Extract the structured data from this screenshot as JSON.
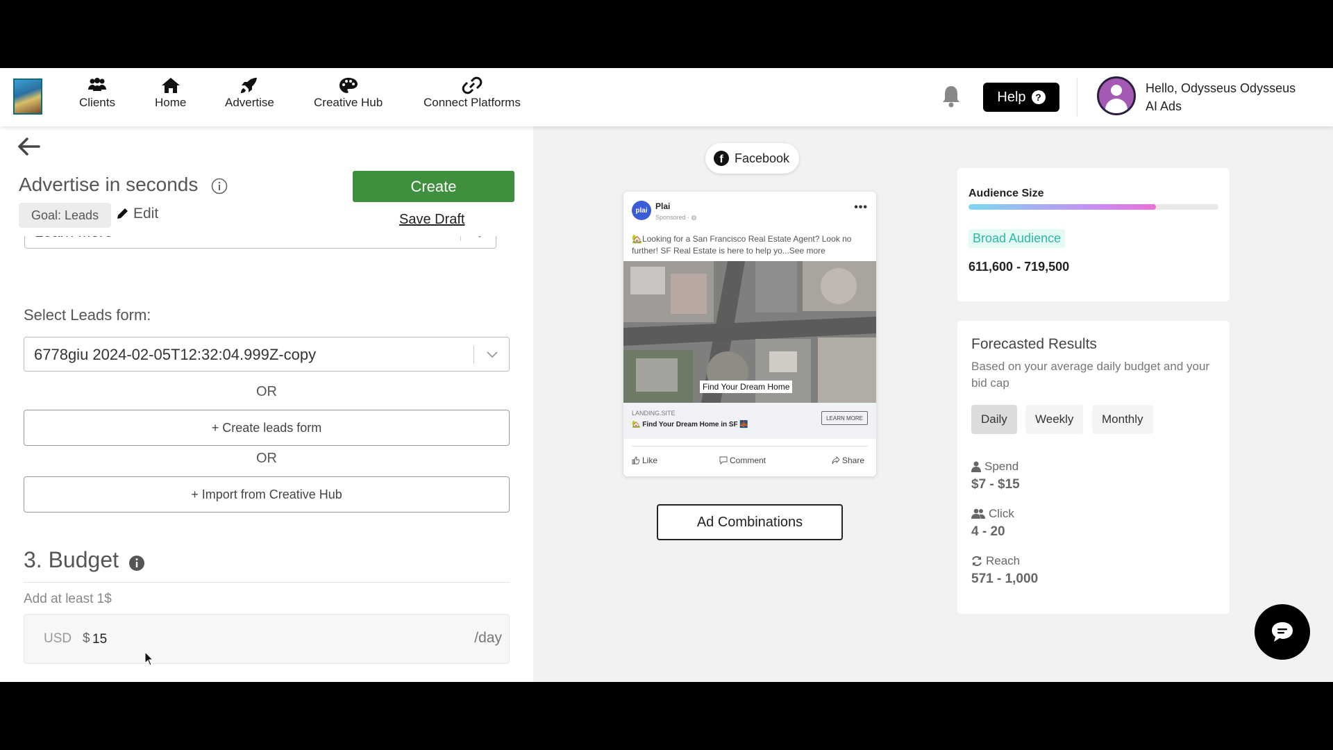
{
  "nav": {
    "items": [
      {
        "label": "Clients",
        "icon": "people-icon"
      },
      {
        "label": "Home",
        "icon": "home-icon"
      },
      {
        "label": "Advertise",
        "icon": "rocket-icon"
      },
      {
        "label": "Creative Hub",
        "icon": "palette-icon"
      },
      {
        "label": "Connect Platforms",
        "icon": "link-icon"
      }
    ],
    "help_label": "Help",
    "help_badge": "?",
    "greeting": "Hello, Odysseus Odysseus",
    "org": "AI Ads"
  },
  "left": {
    "title": "Advertise in seconds",
    "goal_chip": "Goal: Leads",
    "edit_label": "Edit",
    "create_label": "Create",
    "save_draft_label": "Save Draft",
    "cta_value": "Learn More",
    "leads_label": "Select Leads form:",
    "leads_value": "6778giu 2024-02-05T12:32:04.999Z-copy",
    "or_1": "OR",
    "create_form_label": "+ Create leads form",
    "or_2": "OR",
    "import_label": "+ Import from Creative Hub",
    "budget_title": "3. Budget",
    "budget_hint": "Add at least 1$",
    "currency": "USD",
    "dollar": "$",
    "budget_value": "15",
    "per_day": "/day"
  },
  "preview": {
    "platform": "Facebook",
    "page_name": "Plai",
    "logo_text": "plai",
    "sponsored": "Sponsored · ",
    "ad_text": "🏡Looking for a San Francisco Real Estate Agent? Look no further! SF Real Estate is here to help yo...See more",
    "image_label": "Find Your Dream Home",
    "site": "LANDING.SITE",
    "headline": "🏡 Find Your Dream Home in SF 🌉",
    "learn_more": "LEARN MORE",
    "like": "Like",
    "comment": "Comment",
    "share": "Share",
    "combinations_label": "Ad Combinations"
  },
  "audience": {
    "title": "Audience Size",
    "fill_fraction": 0.75,
    "chip": "Broad Audience",
    "range": "611,600 - 719,500"
  },
  "forecast": {
    "title": "Forecasted Results",
    "subtitle": "Based on your average daily budget and your bid cap",
    "tabs": [
      "Daily",
      "Weekly",
      "Monthly"
    ],
    "active_tab": "Daily",
    "metrics": [
      {
        "label": "Spend",
        "value": "$7 - $15",
        "icon": "person-icon"
      },
      {
        "label": "Click",
        "value": "4 - 20",
        "icon": "users-icon"
      },
      {
        "label": "Reach",
        "value": "571 - 1,000",
        "icon": "refresh-icon"
      }
    ]
  },
  "colors": {
    "create_green": "#3f8f3f",
    "audience_chip": "#2bb8a4",
    "help_bg": "#000000"
  }
}
